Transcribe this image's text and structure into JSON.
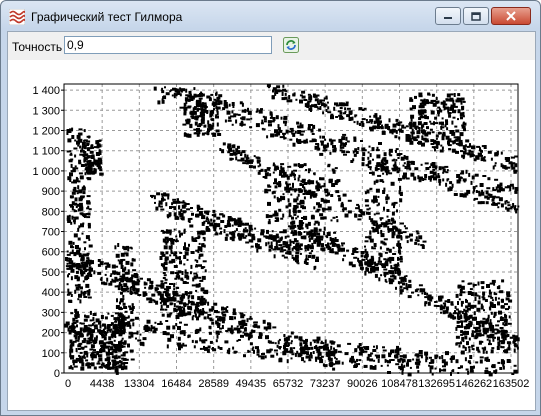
{
  "window": {
    "title": "Графический тест Гилмора",
    "app_icon": "waves-icon",
    "controls": [
      "minimize-icon",
      "maximize-icon",
      "close-icon"
    ]
  },
  "toolbar": {
    "label": "Точность",
    "input_value": "0,9",
    "refresh_icon": "refresh-icon"
  },
  "chart_data": {
    "type": "scatter",
    "title": "",
    "xlabel": "",
    "ylabel": "",
    "x_ticks": [
      "0",
      "4438",
      "13304",
      "16484",
      "28589",
      "49435",
      "65732",
      "73237",
      "90026",
      "108478",
      "132695",
      "146262",
      "163502"
    ],
    "y_ticks": [
      "0",
      "100",
      "200",
      "300",
      "400",
      "500",
      "600",
      "700",
      "800",
      "900",
      "1 000",
      "1 100",
      "1 200",
      "1 300",
      "1 400"
    ],
    "ylim": [
      0,
      1430
    ],
    "grid": true,
    "gridline_style": "dashed",
    "mark_color": "#000000",
    "note_points": "dense recurrence-plot style point cloud, approximate"
  }
}
